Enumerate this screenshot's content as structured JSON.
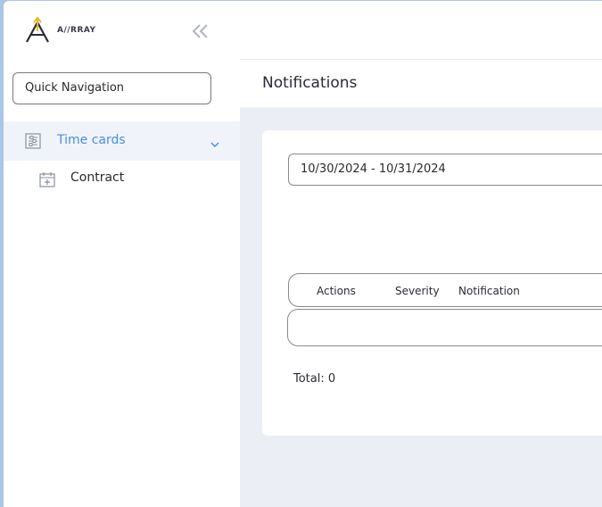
{
  "brand": {
    "name": "A//RRAY"
  },
  "sidebar": {
    "quick_nav": "Quick Navigation",
    "items": [
      {
        "label": "Time cards",
        "icon": "timecard-icon",
        "active": true
      },
      {
        "label": "Contract",
        "icon": "calendar-plus-icon"
      }
    ]
  },
  "main": {
    "title": "Notifications",
    "date_range": "10/30/2024 - 10/31/2024",
    "table": {
      "columns": [
        "Actions",
        "Severity",
        "Notification"
      ]
    },
    "total": "Total: 0"
  },
  "colors": {
    "accent": "#4a8ee0",
    "background": "#ebeef5",
    "logo_gold": "#f0b323"
  }
}
